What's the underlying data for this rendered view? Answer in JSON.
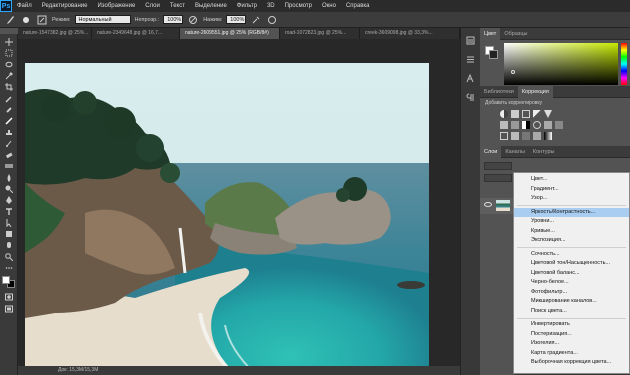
{
  "app": {
    "logo": "Ps"
  },
  "menubar": {
    "items": [
      "Файл",
      "Редактирование",
      "Изображение",
      "Слои",
      "Текст",
      "Выделение",
      "Фильтр",
      "3D",
      "Просмотр",
      "Окно",
      "Справка"
    ]
  },
  "options": {
    "tool_icon": "brush-icon",
    "mode_label": "Режим:",
    "mode_value": "Нормальный",
    "opacity_label": "Непрозр.:",
    "opacity_value": "100%",
    "pressure_label": "Нажим:",
    "pressure_value": "100%"
  },
  "tabs": [
    {
      "label": "nature-1547382.jpg @ 25%..."
    },
    {
      "label": "nature-2349648.jpg @ 16,7..."
    },
    {
      "label": "nature-2609551.jpg @ 25% (RGB/8#)"
    },
    {
      "label": "road-1072823.jpg @ 25%..."
    },
    {
      "label": "creek-3609098.jpg @ 33,3%..."
    }
  ],
  "status": {
    "text": "Док: 15,3M/15,3M"
  },
  "color_panel": {
    "tab1": "Цвет",
    "tab2": "Образцы",
    "hue_color": "#c6e800"
  },
  "adjust_panel": {
    "tab1": "Библиотеки",
    "tab2": "Коррекция",
    "subtitle": "Добавить корректировку"
  },
  "layers_panel": {
    "tab1": "Слои",
    "tab2": "Каналы",
    "tab3": "Контуры"
  },
  "menu": {
    "items": [
      {
        "label": "Цвет..."
      },
      {
        "label": "Градиент..."
      },
      {
        "label": "Узор..."
      },
      {
        "label": "Яркость/Контрастность...",
        "highlight": true
      },
      {
        "label": "Уровни..."
      },
      {
        "label": "Кривые..."
      },
      {
        "label": "Экспозиция..."
      },
      {
        "label": "Сочность..."
      },
      {
        "label": "Цветовой тон/Насыщенность..."
      },
      {
        "label": "Цветовой баланс..."
      },
      {
        "label": "Черно-белое..."
      },
      {
        "label": "Фотофильтр..."
      },
      {
        "label": "Микширование каналов..."
      },
      {
        "label": "Поиск цвета..."
      },
      {
        "label": "Инвертировать"
      },
      {
        "label": "Постеризация..."
      },
      {
        "label": "Изогелия..."
      },
      {
        "label": "Карта градиента..."
      },
      {
        "label": "Выборочная коррекция цвета..."
      }
    ]
  }
}
